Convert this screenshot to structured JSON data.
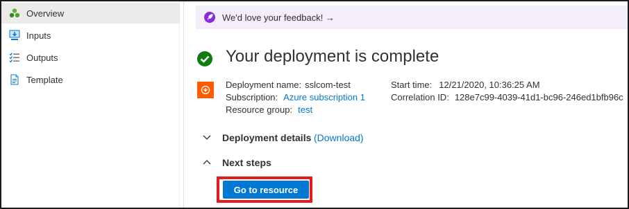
{
  "sidebar": {
    "items": [
      {
        "label": "Overview",
        "icon": "overview-icon",
        "active": true
      },
      {
        "label": "Inputs",
        "icon": "inputs-icon"
      },
      {
        "label": "Outputs",
        "icon": "outputs-icon"
      },
      {
        "label": "Template",
        "icon": "template-icon"
      }
    ]
  },
  "banner": {
    "text": "We'd love your feedback! →",
    "icon": "rocket-icon"
  },
  "main": {
    "title": "Your deployment is complete",
    "status_icon": "check-circle-icon",
    "details_left": [
      {
        "label": "Deployment name:",
        "value": "sslcom-test",
        "link": false
      },
      {
        "label": "Subscription:",
        "value": "Azure subscription 1",
        "link": true
      },
      {
        "label": "Resource group:",
        "value": "test",
        "link": true
      }
    ],
    "details_right": [
      {
        "label": "Start time:",
        "value": "12/21/2020, 10:36:25 AM"
      },
      {
        "label": "Correlation ID:",
        "value": "128e7c99-4039-41d1-bc96-246ed1bfb96c"
      }
    ],
    "deployment_details": {
      "label": "Deployment details",
      "link": "(Download)"
    },
    "next_steps": {
      "label": "Next steps"
    },
    "go_to_resource": "Go to resource"
  },
  "colors": {
    "accent": "#0078d4",
    "success": "#107c10",
    "resource_icon": "#ff5b00",
    "highlight": "#e31d1d",
    "banner_bg": "#f3eef9"
  }
}
